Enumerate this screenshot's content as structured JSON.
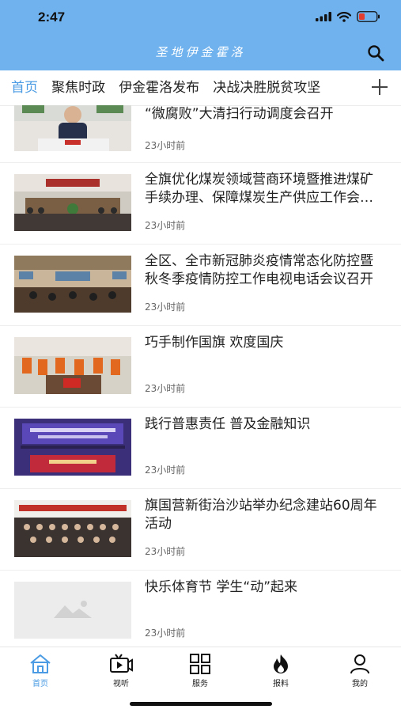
{
  "status_bar": {
    "time": "2:47"
  },
  "header": {
    "title": "圣地伊金霍洛"
  },
  "tabs": [
    {
      "label": "首页",
      "active": true
    },
    {
      "label": "聚焦时政",
      "active": false
    },
    {
      "label": "伊金霍洛发布",
      "active": false
    },
    {
      "label": "决战决胜脱贫攻坚",
      "active": false
    }
  ],
  "news": [
    {
      "title": "“微腐败”大清扫行动调度会召开",
      "time": "23小时前",
      "image": "meeting-speaker-photo"
    },
    {
      "title": "全旗优化煤炭领域营商环境暨推进煤矿手续办理、保障煤炭生产供应工作会议召开",
      "time": "23小时前",
      "image": "conference-room-photo"
    },
    {
      "title": "全区、全市新冠肺炎疫情常态化防控暨秋冬季疫情防控工作电视电话会议召开",
      "time": "23小时前",
      "image": "video-conference-photo"
    },
    {
      "title": "巧手制作国旗 欢度国庆",
      "time": "23小时前",
      "image": "flag-making-photo"
    },
    {
      "title": "践行普惠责任 普及金融知识",
      "time": "23小时前",
      "image": "finance-event-photo"
    },
    {
      "title": "旗国营新街治沙站举办纪念建站60周年活动",
      "time": "23小时前",
      "image": "group-photo"
    },
    {
      "title": "快乐体育节 学生“动”起来",
      "time": "23小时前",
      "image": "image-placeholder"
    }
  ],
  "bottom_nav": [
    {
      "label": "首页",
      "icon": "home-icon",
      "active": true
    },
    {
      "label": "视听",
      "icon": "video-icon",
      "active": false
    },
    {
      "label": "服务",
      "icon": "grid-icon",
      "active": false
    },
    {
      "label": "报料",
      "icon": "fire-icon",
      "active": false
    },
    {
      "label": "我的",
      "icon": "user-icon",
      "active": false
    }
  ],
  "colors": {
    "header_bg": "#6fb2ee",
    "accent": "#4a9be3"
  }
}
